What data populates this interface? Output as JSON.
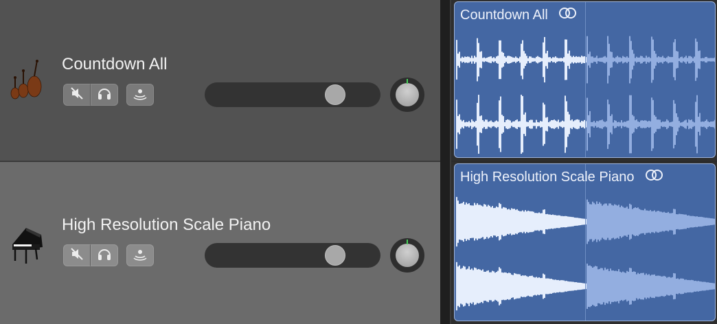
{
  "tracks": [
    {
      "name": "Countdown All",
      "icon": "string-instruments-icon",
      "volume": 0.78,
      "pan": 0.5,
      "region": {
        "title": "Countdown All",
        "type": "drum"
      }
    },
    {
      "name": "High Resolution Scale Piano",
      "icon": "grand-piano-icon",
      "volume": 0.78,
      "pan": 0.5,
      "region": {
        "title": "High Resolution Scale Piano",
        "type": "piano"
      }
    }
  ],
  "colors": {
    "region_fill": "#4467a3",
    "wave_primary": "#e6eefc",
    "wave_secondary": "#93aee0",
    "pan_indicator": "#47d35a"
  },
  "icons": [
    "mute-icon",
    "headphones-icon",
    "input-monitor-icon",
    "loop-icon"
  ]
}
